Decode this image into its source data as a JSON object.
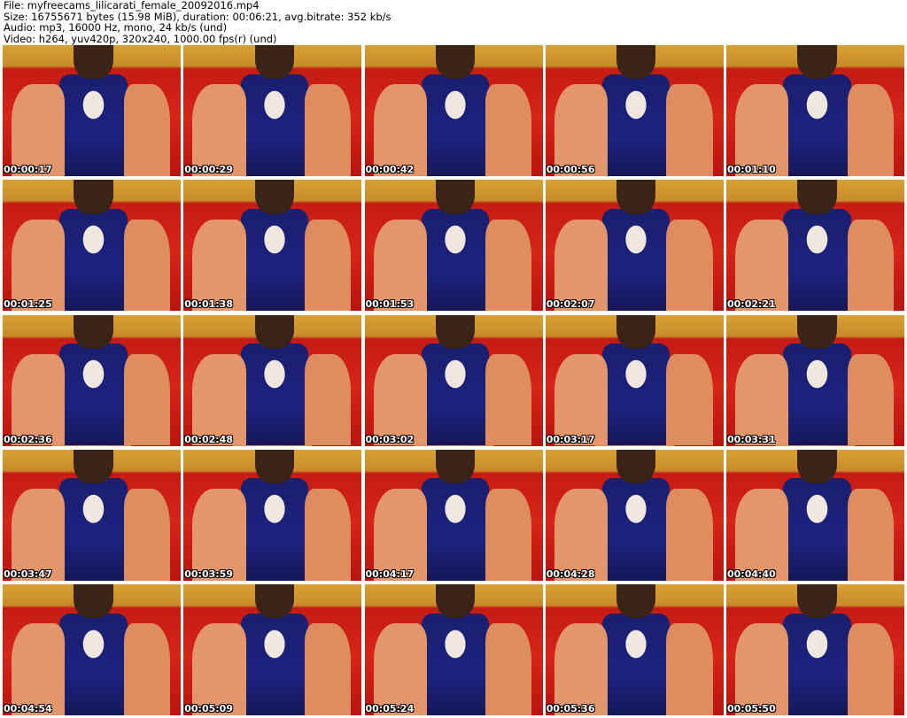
{
  "header": {
    "file_line": "File: myfreecams_lilicarati_female_20092016.mp4",
    "size_line": "Size: 16755671 bytes (15.98 MiB), duration: 00:06:21, avg.bitrate: 352 kb/s",
    "audio_line": "Audio: mp3, 16000 Hz, mono, 24 kb/s (und)",
    "video_line": "Video: h264, yuv420p, 320x240, 1000.00 fps(r) (und)"
  },
  "thumbnails": [
    {
      "timestamp": "00:00:17"
    },
    {
      "timestamp": "00:00:29"
    },
    {
      "timestamp": "00:00:42"
    },
    {
      "timestamp": "00:00:56"
    },
    {
      "timestamp": "00:01:10"
    },
    {
      "timestamp": "00:01:25"
    },
    {
      "timestamp": "00:01:38"
    },
    {
      "timestamp": "00:01:53"
    },
    {
      "timestamp": "00:02:07"
    },
    {
      "timestamp": "00:02:21"
    },
    {
      "timestamp": "00:02:36"
    },
    {
      "timestamp": "00:02:48"
    },
    {
      "timestamp": "00:03:02"
    },
    {
      "timestamp": "00:03:17"
    },
    {
      "timestamp": "00:03:31"
    },
    {
      "timestamp": "00:03:47"
    },
    {
      "timestamp": "00:03:59"
    },
    {
      "timestamp": "00:04:17"
    },
    {
      "timestamp": "00:04:28"
    },
    {
      "timestamp": "00:04:40"
    },
    {
      "timestamp": "00:04:54"
    },
    {
      "timestamp": "00:05:09"
    },
    {
      "timestamp": "00:05:24"
    },
    {
      "timestamp": "00:05:36"
    },
    {
      "timestamp": "00:05:50"
    }
  ]
}
